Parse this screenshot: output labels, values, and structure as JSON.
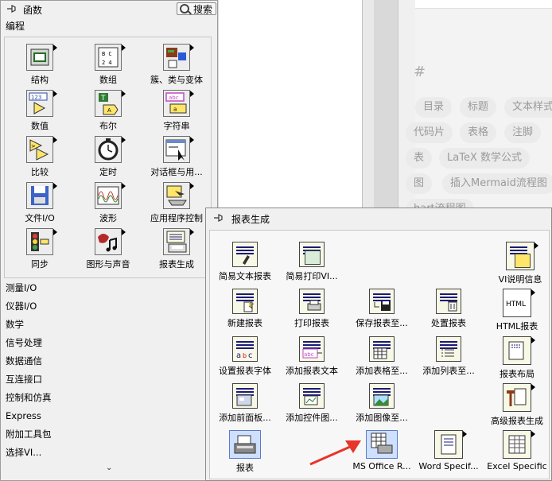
{
  "background_editor": {
    "tags": [
      "目录",
      "标题",
      "文本样式",
      "代码片",
      "表格",
      "注脚",
      "表",
      "LaTeX 数学公式",
      "图",
      "插入Mermaid流程图",
      "hart流程图"
    ]
  },
  "palette": {
    "title": "函数",
    "search_label": "搜索",
    "category_header": "编程",
    "items": [
      {
        "label": "结构",
        "icon": "structures-icon"
      },
      {
        "label": "数组",
        "icon": "array-icon"
      },
      {
        "label": "簇、类与变体",
        "icon": "cluster-class-variant-icon"
      },
      {
        "label": "数值",
        "icon": "numeric-icon"
      },
      {
        "label": "布尔",
        "icon": "boolean-icon"
      },
      {
        "label": "字符串",
        "icon": "string-icon"
      },
      {
        "label": "比较",
        "icon": "comparison-icon"
      },
      {
        "label": "定时",
        "icon": "timing-icon"
      },
      {
        "label": "对话框与用...",
        "icon": "dialog-ui-icon"
      },
      {
        "label": "文件I/O",
        "icon": "file-io-icon"
      },
      {
        "label": "波形",
        "icon": "waveform-icon"
      },
      {
        "label": "应用程序控制",
        "icon": "app-control-icon"
      },
      {
        "label": "同步",
        "icon": "synchronization-icon"
      },
      {
        "label": "图形与声音",
        "icon": "graphics-sound-icon"
      },
      {
        "label": "报表生成",
        "icon": "report-generation-icon"
      }
    ],
    "categories": [
      "测量I/O",
      "仪器I/O",
      "数学",
      "信号处理",
      "数据通信",
      "互连接口",
      "控制和仿真",
      "Express",
      "附加工具包",
      "选择VI..."
    ],
    "scroll_glyph": "⌄"
  },
  "report_palette": {
    "title": "报表生成",
    "items": [
      {
        "label": "简易文本报表",
        "icon": "easy-text-report-icon"
      },
      {
        "label": "简易打印VI...",
        "icon": "easy-print-vi-icon"
      },
      {
        "label": "VI说明信息",
        "icon": "vi-documentation-icon"
      },
      {
        "label": "新建报表",
        "icon": "new-report-icon"
      },
      {
        "label": "打印报表",
        "icon": "print-report-icon"
      },
      {
        "label": "保存报表至...",
        "icon": "save-report-icon"
      },
      {
        "label": "处置报表",
        "icon": "dispose-report-icon"
      },
      {
        "label": "HTML报表",
        "icon": "html-report-icon"
      },
      {
        "label": "设置报表字体",
        "icon": "set-font-icon"
      },
      {
        "label": "添加报表文本",
        "icon": "append-text-icon"
      },
      {
        "label": "添加表格至...",
        "icon": "append-table-icon"
      },
      {
        "label": "添加列表至...",
        "icon": "append-list-icon"
      },
      {
        "label": "报表布局",
        "icon": "report-layout-icon"
      },
      {
        "label": "添加前面板...",
        "icon": "append-front-panel-icon"
      },
      {
        "label": "添加控件图...",
        "icon": "append-control-image-icon"
      },
      {
        "label": "添加图像至...",
        "icon": "append-image-icon"
      },
      {
        "label": "高级报表生成",
        "icon": "advanced-report-icon"
      },
      {
        "label": "报表",
        "icon": "report-express-icon"
      },
      {
        "label": "MS Office R...",
        "icon": "ms-office-report-icon"
      },
      {
        "label": "Word Specif...",
        "icon": "word-specific-icon"
      },
      {
        "label": "Excel Specific",
        "icon": "excel-specific-icon"
      }
    ],
    "html_icon_text": "HTML"
  },
  "annotation": {
    "color": "#e8342a"
  }
}
